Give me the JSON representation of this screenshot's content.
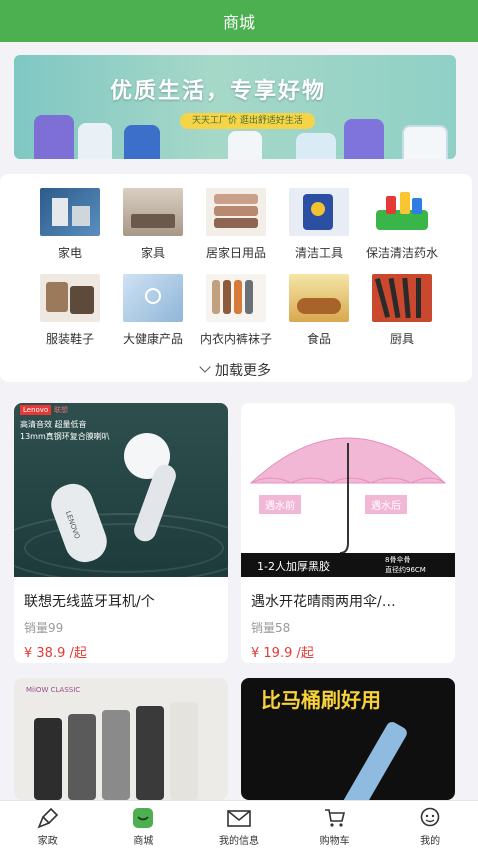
{
  "header": {
    "title": "商城"
  },
  "banner": {
    "headline": "优质生活，专享好物",
    "tagline": "天天工厂价 逛出舒适好生活"
  },
  "categories": [
    {
      "label": "家电",
      "icon": "appliance-icon"
    },
    {
      "label": "家具",
      "icon": "furniture-icon"
    },
    {
      "label": "居家日用品",
      "icon": "towels-icon"
    },
    {
      "label": "清洁工具",
      "icon": "cleaning-tools-icon"
    },
    {
      "label": "保洁清洁药水",
      "icon": "detergent-icon"
    },
    {
      "label": "服装鞋子",
      "icon": "clothing-icon"
    },
    {
      "label": "大健康产品",
      "icon": "health-icon"
    },
    {
      "label": "内衣内裤袜子",
      "icon": "socks-icon"
    },
    {
      "label": "食品",
      "icon": "food-icon"
    },
    {
      "label": "厨具",
      "icon": "kitchenware-icon"
    }
  ],
  "load_more": "加载更多",
  "products": [
    {
      "name": "联想无线蓝牙耳机/个",
      "sales": "销量99",
      "price": "¥ 38.9 /起",
      "image": {
        "brand": "Lenovo",
        "brand_cn": "联想",
        "line1": "高清音效 超量低音",
        "line2": "13mm真钢环复合膜喇叭",
        "earbud_text": "LENOVO"
      }
    },
    {
      "name": "遇水开花晴雨两用伞/…",
      "sales": "销量58",
      "price": "¥ 19.9 /起",
      "image": {
        "before": "遇水前",
        "after": "遇水后",
        "bottom_left": "1-2人加厚黑胶",
        "bottom_right_1": "8骨伞骨",
        "bottom_right_2": "直径约96CM"
      }
    },
    {
      "name": "",
      "image": {
        "brand": "MiiOW CLASSIC"
      }
    },
    {
      "name": "",
      "image": {
        "headline": "比马桶刷好用"
      }
    }
  ],
  "tabbar": [
    {
      "label": "家政",
      "icon": "housekeeping-icon",
      "active": false
    },
    {
      "label": "商城",
      "icon": "mall-icon",
      "active": true
    },
    {
      "label": "我的信息",
      "icon": "envelope-icon",
      "active": false
    },
    {
      "label": "购物车",
      "icon": "cart-icon",
      "active": false
    },
    {
      "label": "我的",
      "icon": "profile-icon",
      "active": false
    }
  ],
  "colors": {
    "primary": "#4caf50",
    "price": "#e53935",
    "background": "#f3f2f6"
  }
}
